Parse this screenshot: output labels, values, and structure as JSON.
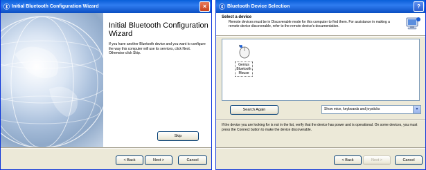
{
  "left_window": {
    "title": "Initial Bluetooth Configuration Wizard",
    "close_glyph": "×",
    "heading": "Initial Bluetooth Configuration Wizard",
    "body": "If you have another Bluetooth device and you want to configure the way this computer will use its services, click Next. Otherwise click Skip.",
    "skip_label": "Skip",
    "back_label": "< Back",
    "next_label": "Next >",
    "cancel_label": "Cancel"
  },
  "right_window": {
    "title": "Bluetooth Device Selection",
    "help_glyph": "?",
    "header_title": "Select a device",
    "header_text": "Remote devices must be in Discoverable mode for this computer to find them. For assistance in making a remote device discoverable, refer to the remote device's documentation.",
    "device_label_lines": [
      "Genius",
      "Bluetooth",
      "Mouse"
    ],
    "search_again_label": "Search Again",
    "filter_value": "Show mice, keyboards and joysticks",
    "info_text": "If the device you are looking for is not in the list, verify that the device has power and is operational. On some devices, you must press the Connect button to make the device discoverable.",
    "back_label": "< Back",
    "next_label": "Next >",
    "cancel_label": "Cancel"
  },
  "icons": {
    "bluetooth": "bluetooth-icon",
    "globe": "globe-illustration",
    "computer": "computer-icon",
    "mouse": "mouse-icon"
  }
}
